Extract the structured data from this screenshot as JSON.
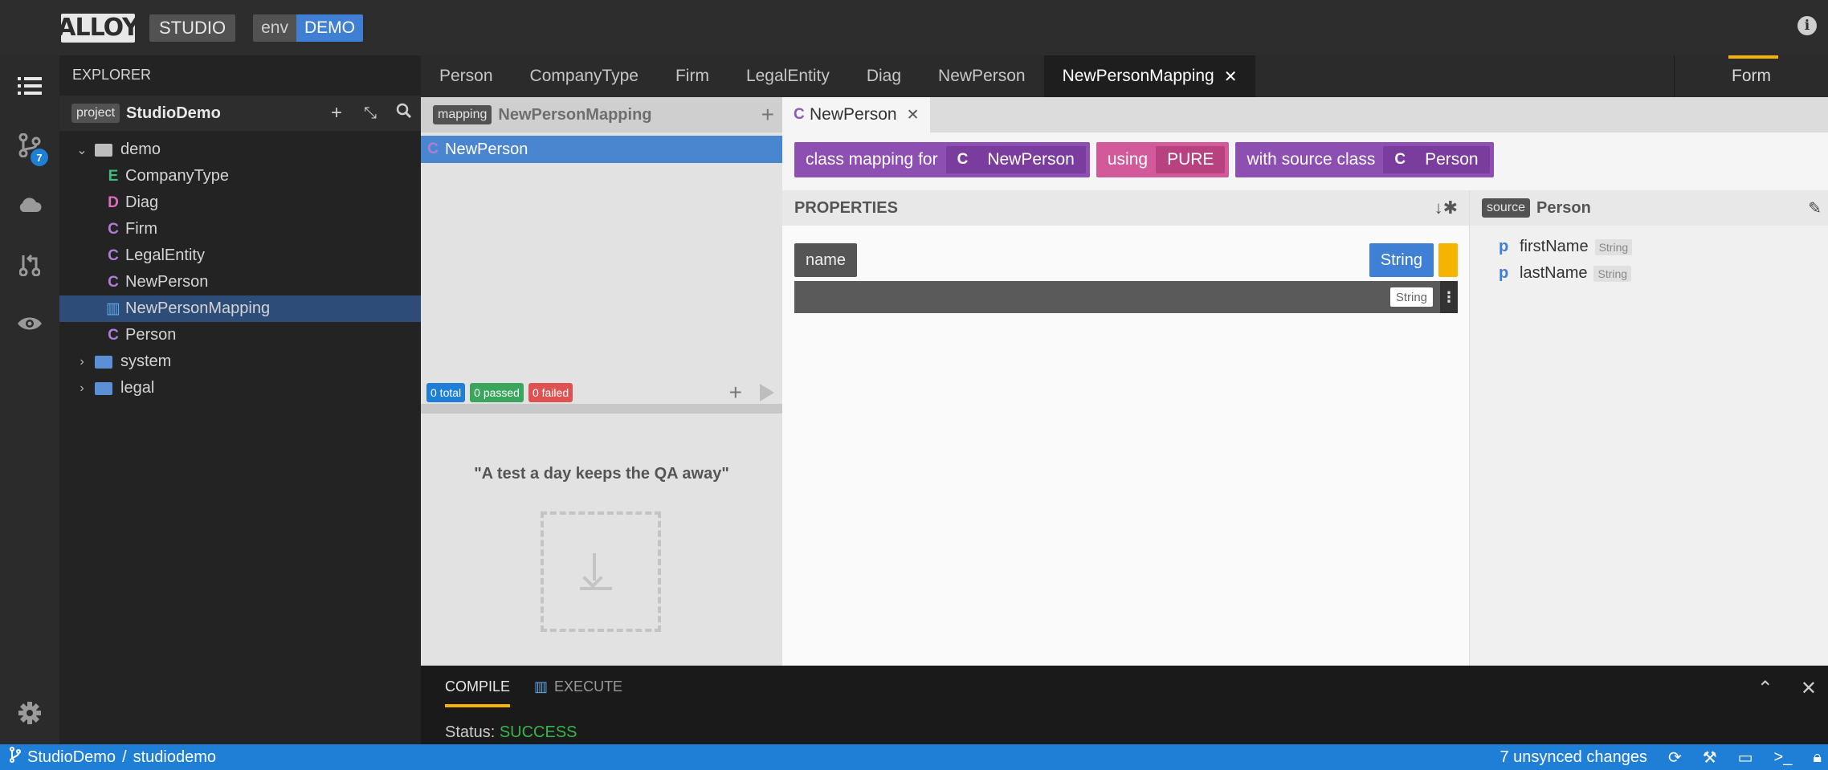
{
  "header": {
    "logo": "ALLOY",
    "studio": "STUDIO",
    "env_key": "env",
    "env_value": "DEMO"
  },
  "activity": {
    "badge_count": "7"
  },
  "explorer": {
    "title": "EXPLORER",
    "project_tag": "project",
    "project_name": "StudioDemo",
    "tree": [
      {
        "label": "demo",
        "kind": "folder",
        "expanded": true
      },
      {
        "letter": "E",
        "label": "CompanyType"
      },
      {
        "letter": "D",
        "label": "Diag"
      },
      {
        "letter": "C",
        "label": "Firm"
      },
      {
        "letter": "C",
        "label": "LegalEntity"
      },
      {
        "letter": "C",
        "label": "NewPerson"
      },
      {
        "label": "NewPersonMapping",
        "kind": "mapping",
        "selected": true
      },
      {
        "letter": "C",
        "label": "Person"
      },
      {
        "label": "system",
        "kind": "folder"
      },
      {
        "label": "legal",
        "kind": "folder"
      }
    ]
  },
  "tabs": [
    {
      "label": "Person"
    },
    {
      "label": "CompanyType"
    },
    {
      "label": "Firm"
    },
    {
      "label": "LegalEntity"
    },
    {
      "label": "Diag"
    },
    {
      "label": "NewPerson"
    },
    {
      "label": "NewPersonMapping",
      "active": true
    }
  ],
  "form_tab": "Form",
  "mapping": {
    "tag": "mapping",
    "name": "NewPersonMapping",
    "item_letter": "C",
    "item": "NewPerson",
    "tests": {
      "total": "0 total",
      "passed": "0 passed",
      "failed": "0 failed"
    },
    "quote": "\"A test a day keeps the QA away\""
  },
  "editor": {
    "tab_letter": "C",
    "tab_label": "NewPerson",
    "chip1_label": "class mapping for",
    "chip1_letter": "C",
    "chip1_value": "NewPerson",
    "chip2_label": "using",
    "chip2_value": "PURE",
    "chip3_label": "with source class",
    "chip3_letter": "C",
    "chip3_value": "Person",
    "properties_title": "PROPERTIES",
    "prop_name": "name",
    "prop_type": "String",
    "expr_type": "String",
    "source_tag": "source",
    "source_name": "Person",
    "source_props": [
      {
        "p": "p",
        "name": "firstName",
        "type": "String"
      },
      {
        "p": "p",
        "name": "lastName",
        "type": "String"
      }
    ]
  },
  "console": {
    "compile": "COMPILE",
    "execute": "EXECUTE",
    "status_label": "Status:",
    "status_value": "SUCCESS"
  },
  "statusbar": {
    "project": "StudioDemo",
    "separator": "/",
    "workspace": "studiodemo",
    "changes": "7 unsynced changes"
  }
}
